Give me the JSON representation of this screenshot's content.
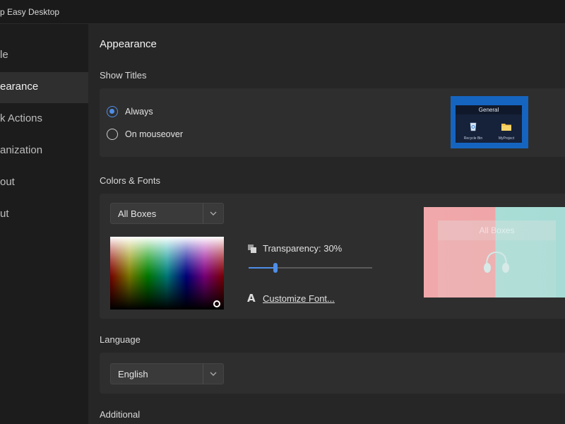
{
  "window": {
    "title": "p Easy Desktop"
  },
  "sidebar": {
    "items": [
      {
        "label": "le",
        "active": false
      },
      {
        "label": "earance",
        "active": true
      },
      {
        "label": "k Actions",
        "active": false
      },
      {
        "label": "anization",
        "active": false
      },
      {
        "label": "out",
        "active": false
      },
      {
        "label": "ut",
        "active": false
      }
    ]
  },
  "main": {
    "heading": "Appearance",
    "show_titles": {
      "label": "Show Titles",
      "options": [
        {
          "label": "Always",
          "selected": true
        },
        {
          "label": "On mouseover",
          "selected": false
        }
      ],
      "preview": {
        "box_title": "General",
        "icons": [
          {
            "icon": "recycle-bin-icon",
            "caption": "Recycle Bin"
          },
          {
            "icon": "folder-icon",
            "caption": "MyProject"
          }
        ]
      }
    },
    "colors_fonts": {
      "label": "Colors & Fonts",
      "box_select": {
        "value": "All Boxes"
      },
      "transparency": {
        "label": "Transparency: 30%",
        "value": 0.3
      },
      "customize_font": {
        "label": "Customize Font..."
      },
      "preview": {
        "box_title": "All Boxes"
      }
    },
    "language": {
      "label": "Language",
      "select": {
        "value": "English"
      }
    },
    "additional": {
      "label": "Additional"
    }
  },
  "colors": {
    "accent": "#4f8ee8",
    "preview_title_bg": "#1565c0",
    "preview_pink": "#f1a8aa",
    "preview_teal": "#a9ddd6"
  }
}
